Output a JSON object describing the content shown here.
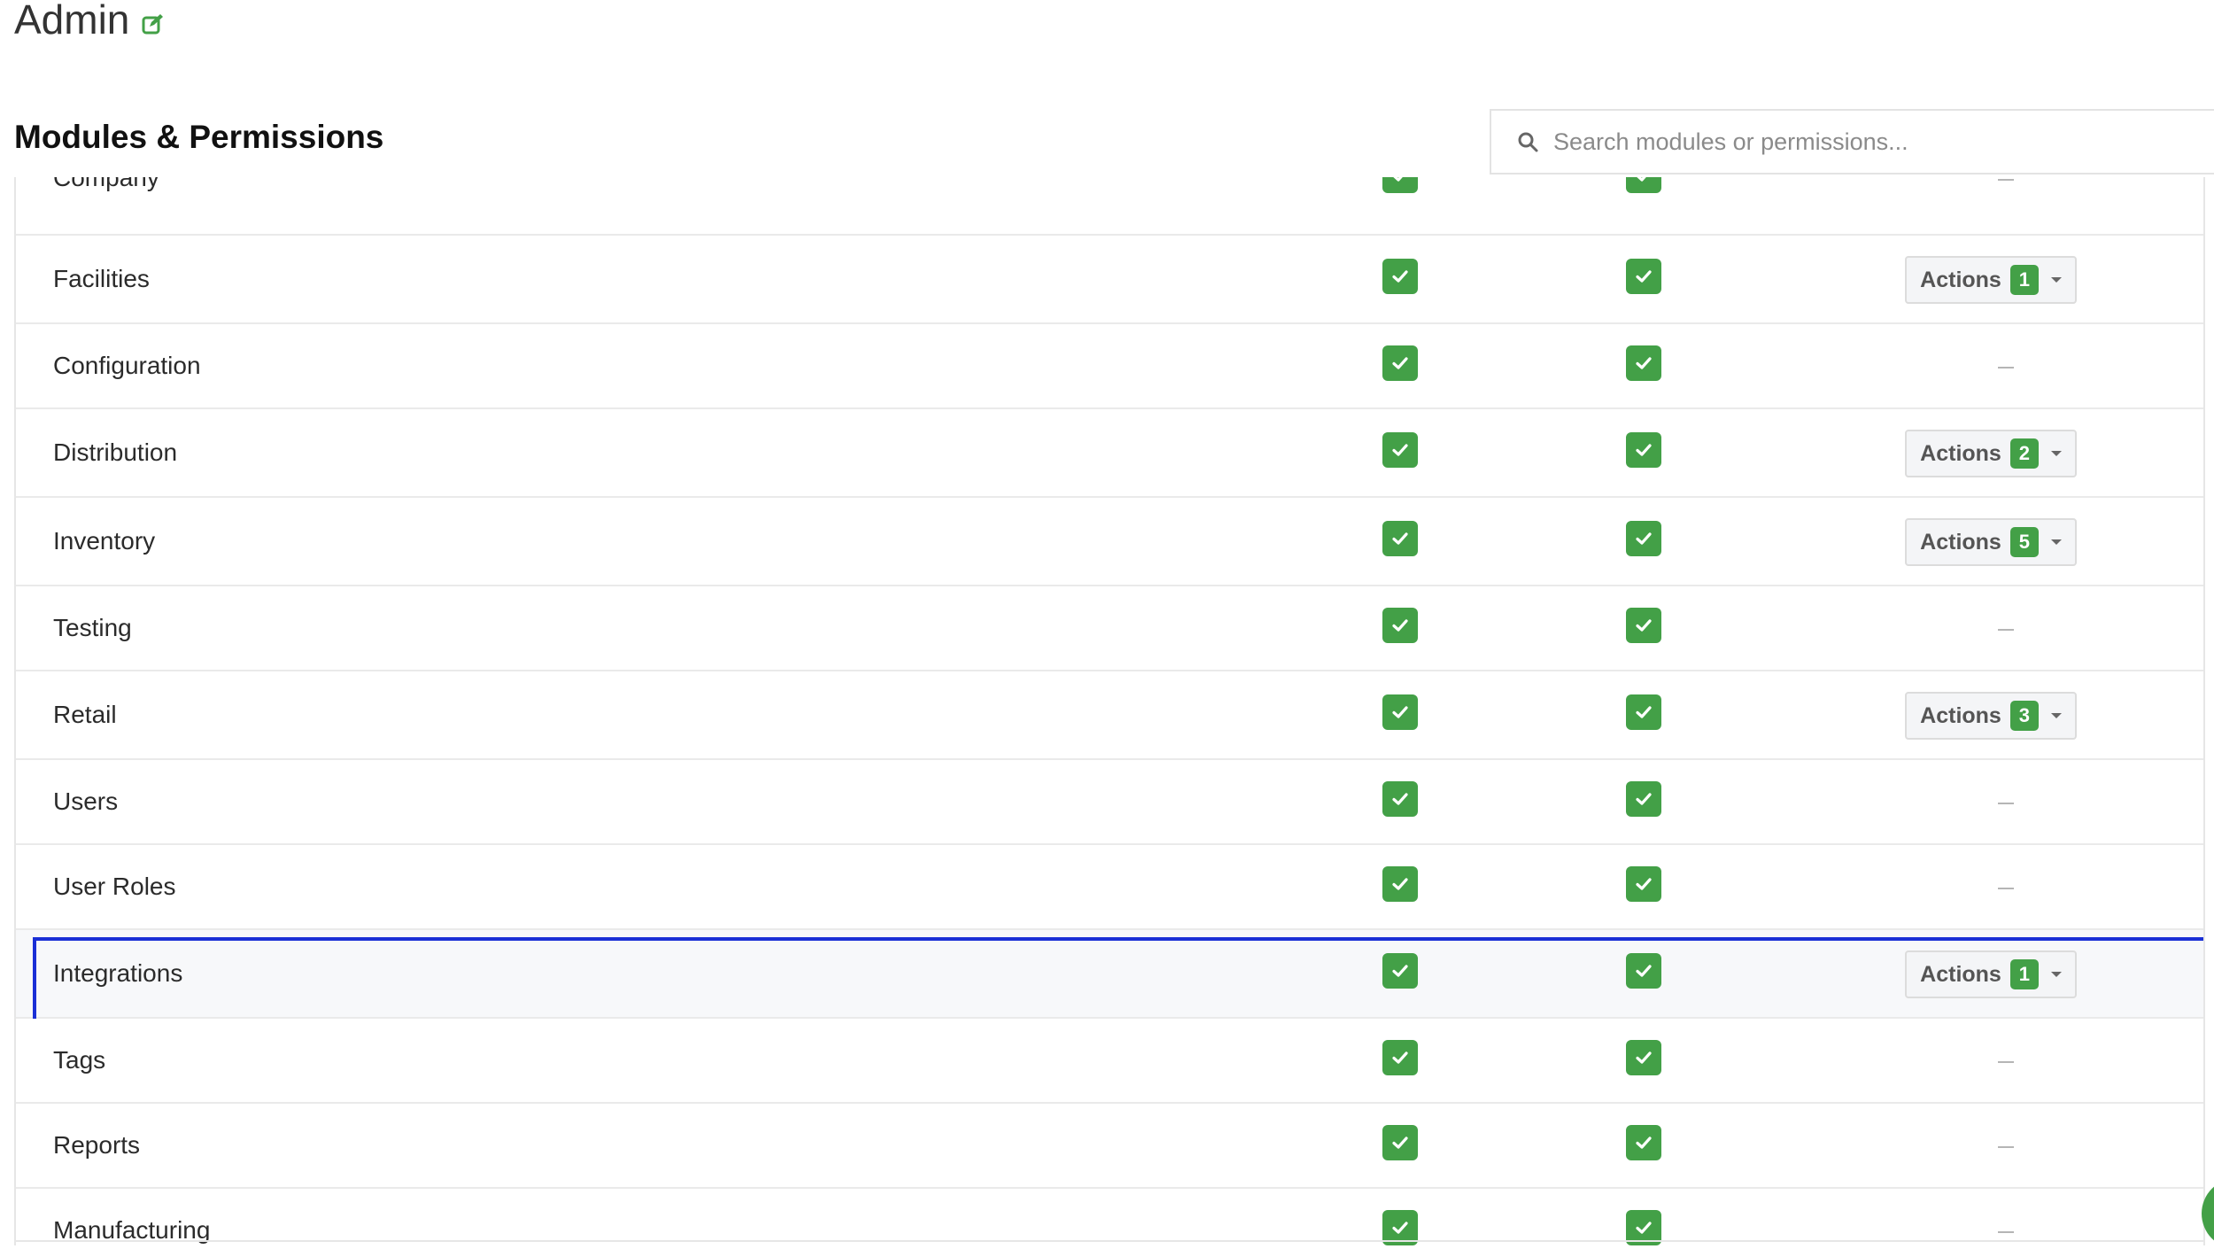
{
  "page": {
    "title": "Admin",
    "edit_icon": "edit-icon"
  },
  "section": {
    "title": "Modules & Permissions"
  },
  "search": {
    "placeholder": "Search modules or permissions...",
    "value": "",
    "icon": "search-icon"
  },
  "colors": {
    "accent_green": "#43a047",
    "highlight_border": "#1a2fd6"
  },
  "modules": [
    {
      "name": "Company",
      "perm1": true,
      "perm2": true,
      "actions": null
    },
    {
      "name": "Facilities",
      "perm1": true,
      "perm2": true,
      "actions": {
        "label": "Actions",
        "count": "1"
      }
    },
    {
      "name": "Configuration",
      "perm1": true,
      "perm2": true,
      "actions": null
    },
    {
      "name": "Distribution",
      "perm1": true,
      "perm2": true,
      "actions": {
        "label": "Actions",
        "count": "2"
      }
    },
    {
      "name": "Inventory",
      "perm1": true,
      "perm2": true,
      "actions": {
        "label": "Actions",
        "count": "5"
      }
    },
    {
      "name": "Testing",
      "perm1": true,
      "perm2": true,
      "actions": null
    },
    {
      "name": "Retail",
      "perm1": true,
      "perm2": true,
      "actions": {
        "label": "Actions",
        "count": "3"
      }
    },
    {
      "name": "Users",
      "perm1": true,
      "perm2": true,
      "actions": null
    },
    {
      "name": "User Roles",
      "perm1": true,
      "perm2": true,
      "actions": null
    },
    {
      "name": "Integrations",
      "perm1": true,
      "perm2": true,
      "actions": {
        "label": "Actions",
        "count": "1"
      },
      "highlighted": true
    },
    {
      "name": "Tags",
      "perm1": true,
      "perm2": true,
      "actions": null
    },
    {
      "name": "Reports",
      "perm1": true,
      "perm2": true,
      "actions": null
    },
    {
      "name": "Manufacturing",
      "perm1": true,
      "perm2": true,
      "actions": null
    }
  ]
}
